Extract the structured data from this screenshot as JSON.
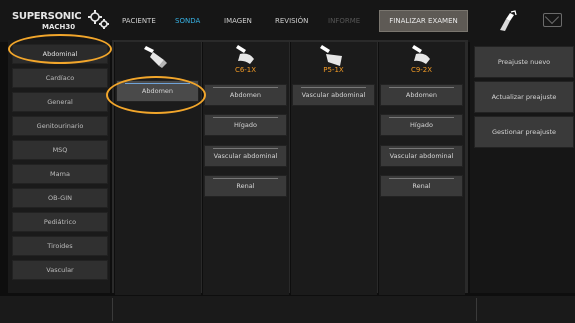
{
  "logo": {
    "line1": "SUPERSONIC",
    "line2": "MACH30"
  },
  "nav": {
    "patient": "PACIENTE",
    "probe": "SONDA",
    "image": "IMAGEN",
    "review": "REVISIÓN",
    "report": "INFORME",
    "finish_exam": "FINALIZAR EXAMEN"
  },
  "left_menu": [
    "Abdominal",
    "Cardíaco",
    "General",
    "Genitourinario",
    "MSQ",
    "Mama",
    "OB-GIN",
    "Pediátrico",
    "Tiroides",
    "Vascular"
  ],
  "probes": [
    {
      "label": "",
      "apps": [
        "Abdomen"
      ]
    },
    {
      "label": "C6-1X",
      "apps": [
        "Abdomen",
        "Hígado",
        "Vascular abdominal",
        "Renal"
      ]
    },
    {
      "label": "P5-1X",
      "apps": [
        "Vascular abdominal"
      ]
    },
    {
      "label": "C9-2X",
      "apps": [
        "Abdomen",
        "Hígado",
        "Vascular abdominal",
        "Renal"
      ]
    }
  ],
  "right_menu": {
    "new_preset": "Preajuste nuevo",
    "update_preset": "Actualizar preajuste",
    "manage_preset": "Gestionar preajuste"
  },
  "colors": {
    "active": "#37b2e4",
    "probe_label": "#f29a25",
    "highlight": "#f2a62b"
  }
}
